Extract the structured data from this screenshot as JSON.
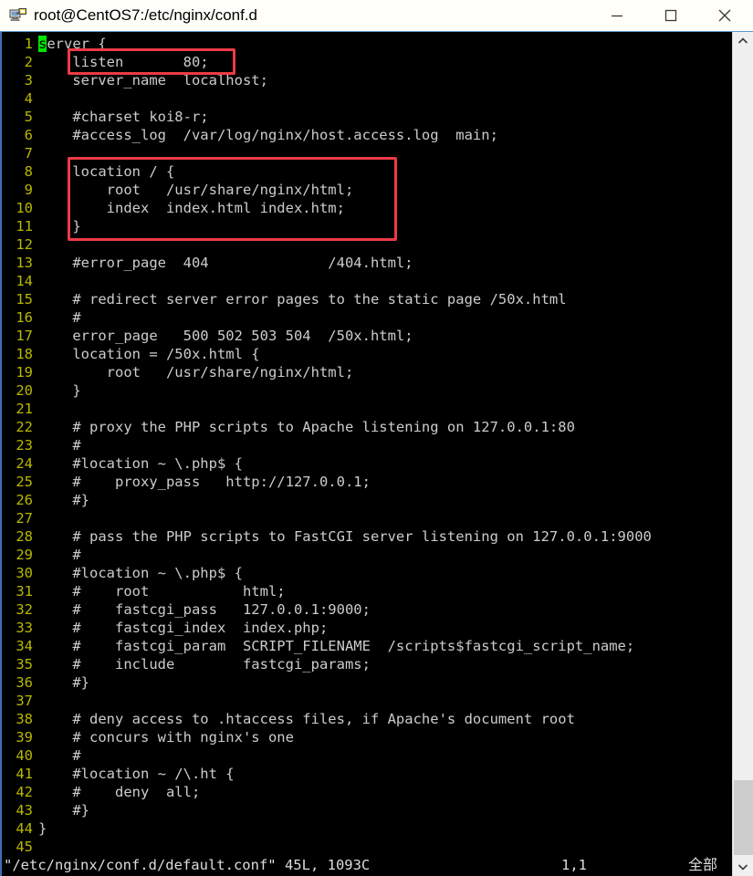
{
  "window": {
    "title": "root@CentOS7:/etc/nginx/conf.d",
    "icon": "putty-terminal-icon",
    "buttons": {
      "minimize": "minimize-icon",
      "maximize": "maximize-icon",
      "close": "close-icon"
    }
  },
  "editor": {
    "cursor_char": "s",
    "lines": [
      {
        "n": "1",
        "text": "erver {"
      },
      {
        "n": "2",
        "text": "    listen       80;"
      },
      {
        "n": "3",
        "text": "    server_name  localhost;"
      },
      {
        "n": "4",
        "text": ""
      },
      {
        "n": "5",
        "text": "    #charset koi8-r;"
      },
      {
        "n": "6",
        "text": "    #access_log  /var/log/nginx/host.access.log  main;"
      },
      {
        "n": "7",
        "text": ""
      },
      {
        "n": "8",
        "text": "    location / {"
      },
      {
        "n": "9",
        "text": "        root   /usr/share/nginx/html;"
      },
      {
        "n": "10",
        "text": "        index  index.html index.htm;"
      },
      {
        "n": "11",
        "text": "    }"
      },
      {
        "n": "12",
        "text": ""
      },
      {
        "n": "13",
        "text": "    #error_page  404              /404.html;"
      },
      {
        "n": "14",
        "text": ""
      },
      {
        "n": "15",
        "text": "    # redirect server error pages to the static page /50x.html"
      },
      {
        "n": "16",
        "text": "    #"
      },
      {
        "n": "17",
        "text": "    error_page   500 502 503 504  /50x.html;"
      },
      {
        "n": "18",
        "text": "    location = /50x.html {"
      },
      {
        "n": "19",
        "text": "        root   /usr/share/nginx/html;"
      },
      {
        "n": "20",
        "text": "    }"
      },
      {
        "n": "21",
        "text": ""
      },
      {
        "n": "22",
        "text": "    # proxy the PHP scripts to Apache listening on 127.0.0.1:80"
      },
      {
        "n": "23",
        "text": "    #"
      },
      {
        "n": "24",
        "text": "    #location ~ \\.php$ {"
      },
      {
        "n": "25",
        "text": "    #    proxy_pass   http://127.0.0.1;"
      },
      {
        "n": "26",
        "text": "    #}"
      },
      {
        "n": "27",
        "text": ""
      },
      {
        "n": "28",
        "text": "    # pass the PHP scripts to FastCGI server listening on 127.0.0.1:9000"
      },
      {
        "n": "29",
        "text": "    #"
      },
      {
        "n": "30",
        "text": "    #location ~ \\.php$ {"
      },
      {
        "n": "31",
        "text": "    #    root           html;"
      },
      {
        "n": "32",
        "text": "    #    fastcgi_pass   127.0.0.1:9000;"
      },
      {
        "n": "33",
        "text": "    #    fastcgi_index  index.php;"
      },
      {
        "n": "34",
        "text": "    #    fastcgi_param  SCRIPT_FILENAME  /scripts$fastcgi_script_name;"
      },
      {
        "n": "35",
        "text": "    #    include        fastcgi_params;"
      },
      {
        "n": "36",
        "text": "    #}"
      },
      {
        "n": "37",
        "text": ""
      },
      {
        "n": "38",
        "text": "    # deny access to .htaccess files, if Apache's document root"
      },
      {
        "n": "39",
        "text": "    # concurs with nginx's one"
      },
      {
        "n": "40",
        "text": "    #"
      },
      {
        "n": "41",
        "text": "    #location ~ /\\.ht {"
      },
      {
        "n": "42",
        "text": "    #    deny  all;"
      },
      {
        "n": "43",
        "text": "    #}"
      },
      {
        "n": "44",
        "text": "}"
      },
      {
        "n": "45",
        "text": ""
      }
    ]
  },
  "annotations": [
    {
      "id": "redbox-listen",
      "label": "listen-directive-highlight",
      "color": "#ed3b45"
    },
    {
      "id": "redbox-location",
      "label": "location-block-highlight",
      "color": "#ed3b45"
    }
  ],
  "status": {
    "file": "\"/etc/nginx/conf.d/default.conf\" 45L, 1093C",
    "position": "1,1",
    "scope": "全部"
  },
  "scrollbar": {
    "up_icon": "chevron-up-icon",
    "down_icon": "chevron-down-icon"
  },
  "colors": {
    "line_number": "#b8b800",
    "text": "#cccccc",
    "cursor": "#00e500",
    "annotation": "#ed3b45",
    "background": "#000000",
    "titlebar_border": "#5a9bd5"
  }
}
